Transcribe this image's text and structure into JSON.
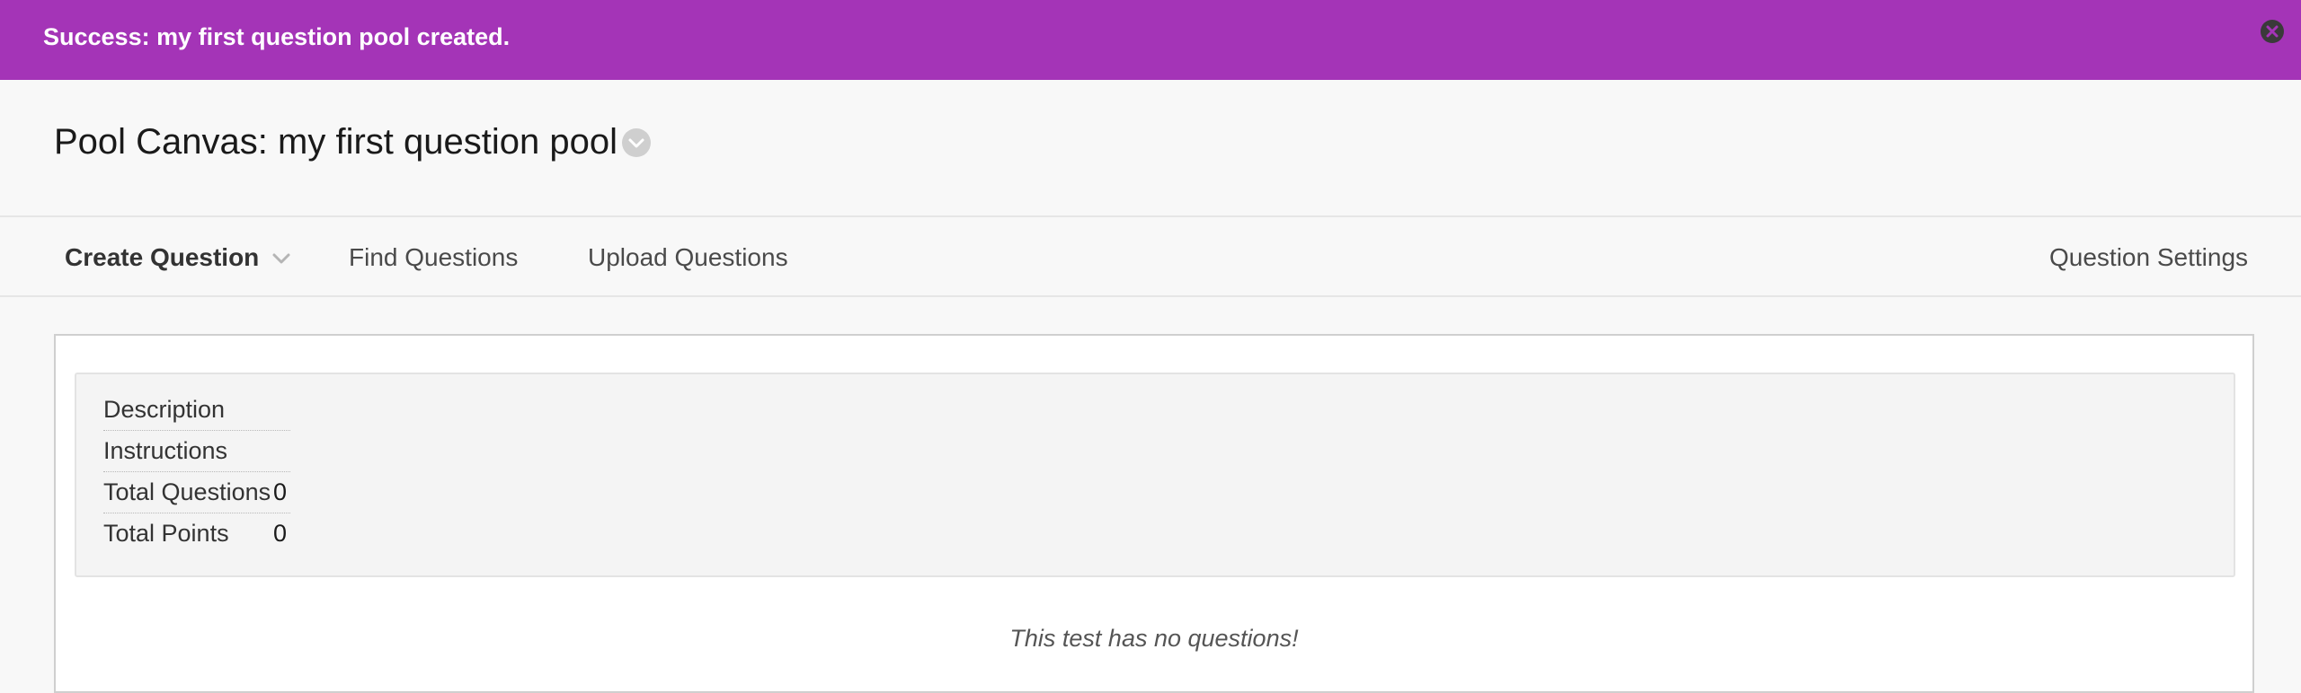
{
  "banner": {
    "message": "Success: my first question pool created.",
    "close_icon": "close-circle-icon",
    "color": "#a434b7"
  },
  "header": {
    "title": "Pool Canvas: my first question pool",
    "menu_icon": "chevron-down-circle-icon"
  },
  "toolbar": {
    "create_question": "Create Question",
    "find_questions": "Find Questions",
    "upload_questions": "Upload Questions",
    "question_settings": "Question Settings"
  },
  "pool_info": {
    "rows": [
      {
        "label": "Description",
        "value": ""
      },
      {
        "label": "Instructions",
        "value": ""
      },
      {
        "label": "Total Questions",
        "value": "0"
      },
      {
        "label": "Total Points",
        "value": "0"
      }
    ]
  },
  "empty_message": "This test has no questions!"
}
